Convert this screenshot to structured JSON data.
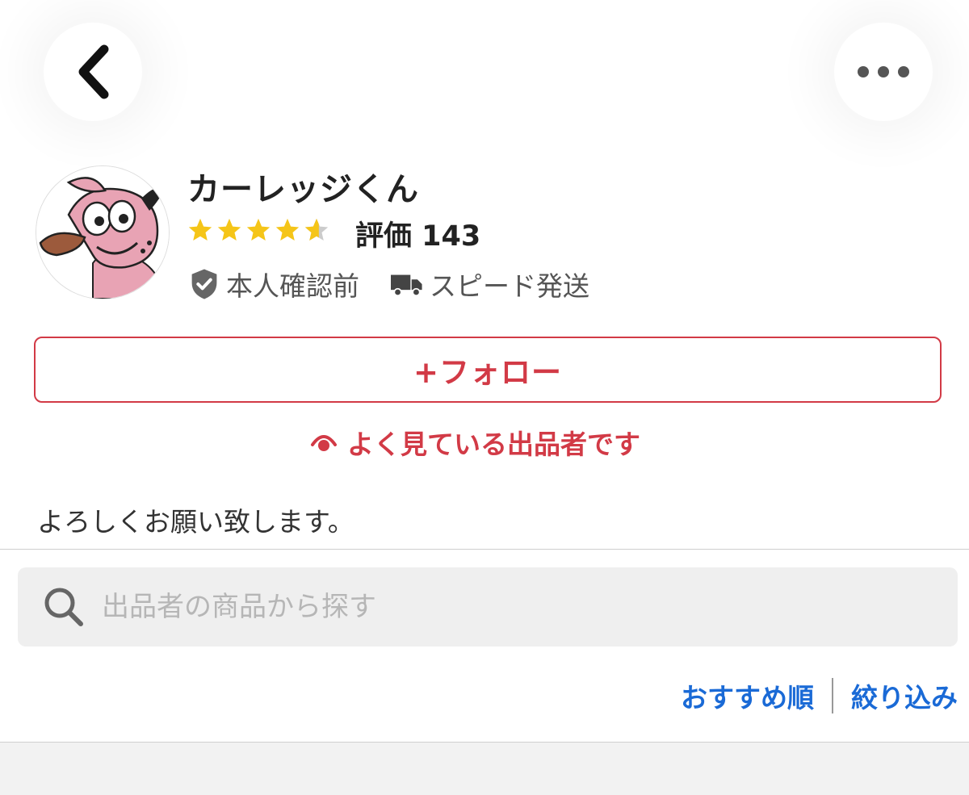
{
  "header": {
    "back_icon": "chevron-left-icon",
    "more_icon": "more-horizontal-icon"
  },
  "seller": {
    "name": "カーレッジくん",
    "rating": 4.5,
    "rating_label": "評価 143",
    "verification_label": "本人確認前",
    "shipping_label": "スピード発送",
    "avatar": "cartoon-dog-avatar"
  },
  "follow_button": {
    "label": "+フォロー"
  },
  "watch_notice": {
    "label": "よく見ている出品者です"
  },
  "bio": "よろしくお願い致します。",
  "search": {
    "placeholder": "出品者の商品から探す",
    "value": ""
  },
  "sort": {
    "recommended_label": "おすすめ順",
    "filter_label": "絞り込み"
  },
  "colors": {
    "accent": "#d23a46",
    "link": "#1a6ad6",
    "star": "#f5c518"
  }
}
